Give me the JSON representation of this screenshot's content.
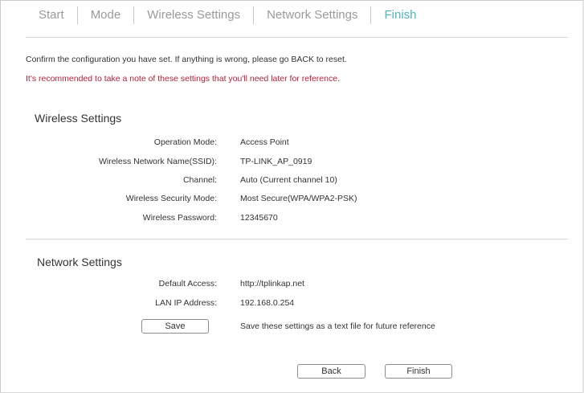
{
  "steps": {
    "start": "Start",
    "mode": "Mode",
    "wireless_settings": "Wireless Settings",
    "network_settings": "Network Settings",
    "finish": "Finish"
  },
  "messages": {
    "confirm": "Confirm the configuration you have set. If anything is wrong, please go BACK to reset.",
    "note": "It's recommended to take a note of these settings that you'll need later for reference."
  },
  "wireless": {
    "title": "Wireless Settings",
    "operation_mode_label": "Operation Mode:",
    "operation_mode_value": "Access Point",
    "ssid_label": "Wireless Network Name(SSID):",
    "ssid_value": "TP-LINK_AP_0919",
    "channel_label": "Channel:",
    "channel_value": "Auto (Current channel 10)",
    "security_label": "Wireless Security Mode:",
    "security_value": "Most Secure(WPA/WPA2-PSK)",
    "password_label": "Wireless Password:",
    "password_value": "12345670"
  },
  "network": {
    "title": "Network Settings",
    "default_access_label": "Default Access:",
    "default_access_value": "http://tplinkap.net",
    "lan_ip_label": "LAN IP Address:",
    "lan_ip_value": "192.168.0.254",
    "save_label": "Save",
    "save_hint": "Save these settings as a text file for future reference"
  },
  "footer": {
    "back_label": "Back",
    "finish_label": "Finish"
  },
  "colors": {
    "active_step": "#4fb4c2",
    "inactive_step": "#9a9a9a",
    "note": "#b3203a"
  }
}
